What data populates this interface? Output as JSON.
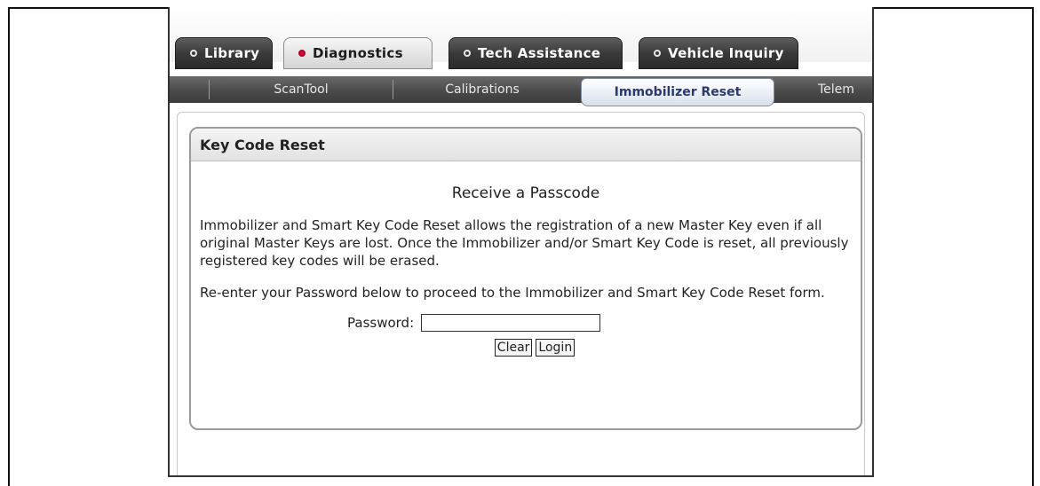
{
  "main_tabs": [
    {
      "label": "Library"
    },
    {
      "label": "Diagnostics"
    },
    {
      "label": "Tech Assistance"
    },
    {
      "label": "Vehicle Inquiry"
    }
  ],
  "sub_tabs": [
    {
      "label": "ScanTool"
    },
    {
      "label": "Calibrations"
    },
    {
      "label": "Immobilizer Reset"
    },
    {
      "label": "Telem"
    }
  ],
  "panel": {
    "title": "Key Code Reset",
    "heading": "Receive a Passcode",
    "paragraph1": "Immobilizer and Smart Key Code Reset allows the registration of a new Master Key even if all original Master Keys are lost. Once the Immobilizer and/or Smart Key Code is reset, all previously registered key codes will be erased.",
    "paragraph2": "Re-enter your Password below to proceed to the Immobilizer and Smart Key Code Reset form.",
    "password_label": "Password:",
    "password_value": "",
    "clear_label": "Clear",
    "login_label": "Login"
  }
}
